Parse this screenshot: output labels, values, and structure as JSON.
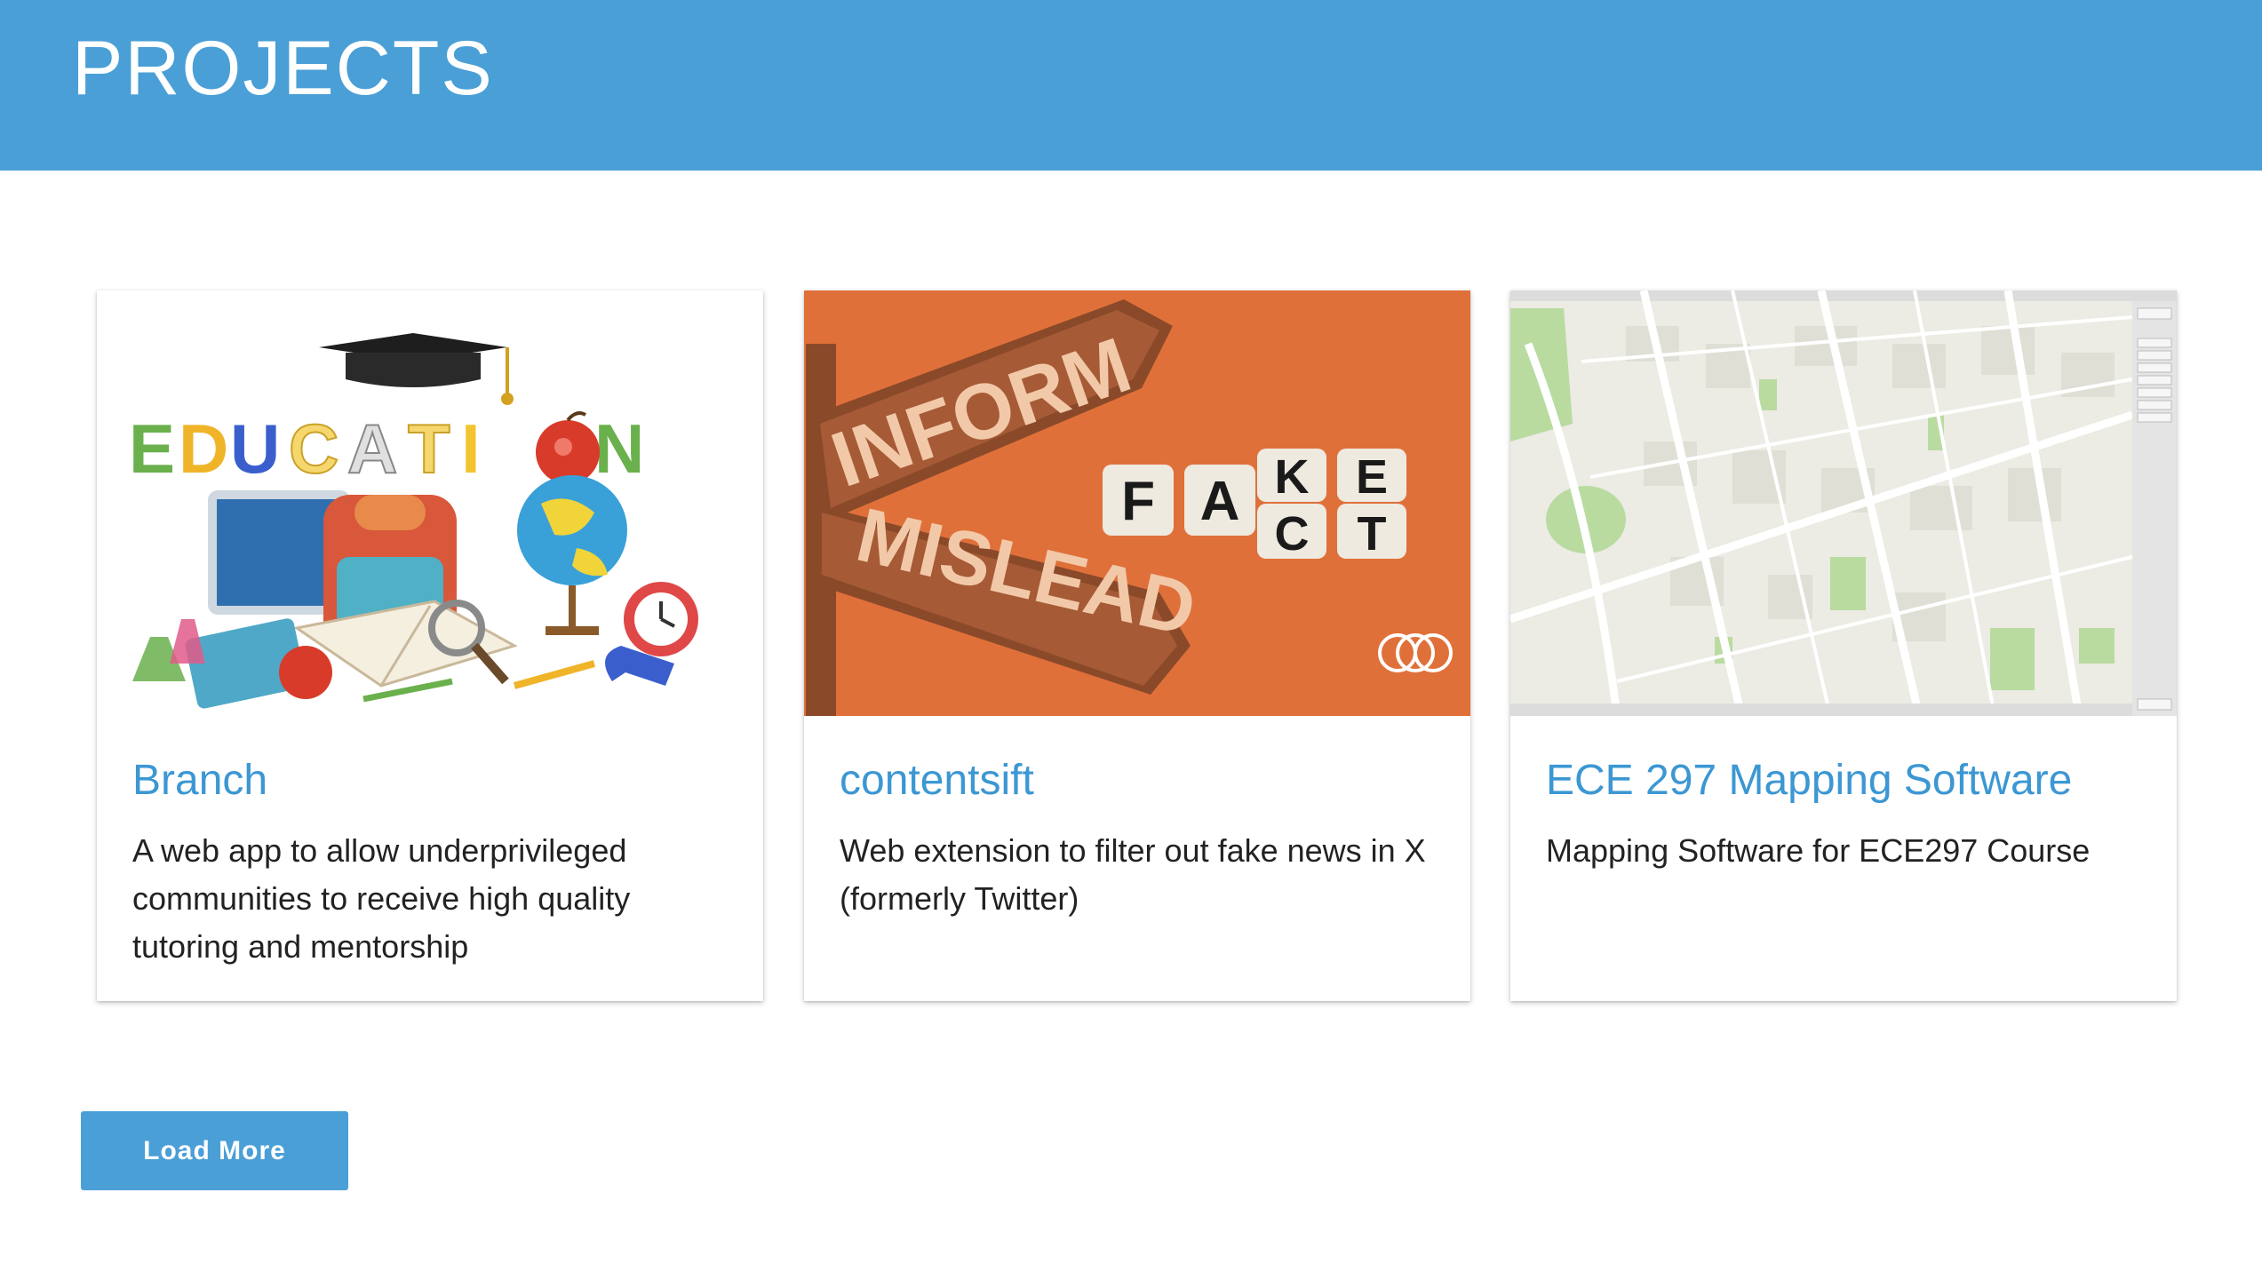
{
  "header": {
    "title": "PROJECTS"
  },
  "projects": [
    {
      "title": "Branch",
      "description": "A web app to allow underprivileged communities to receive high quality tutoring and mentorship",
      "image": {
        "icon": "education-illustration",
        "word": "EDUCATION"
      }
    },
    {
      "title": "contentsift",
      "description": "Web extension to filter out fake news in X (formerly Twitter)",
      "image": {
        "icon": "signpost-illustration",
        "sign_top": "INFORM",
        "sign_bottom": "MISLEAD",
        "dice_top": [
          "K",
          "E"
        ],
        "dice_bottom": [
          "F",
          "A",
          "C",
          "T"
        ],
        "background_color": "#e0703a"
      }
    },
    {
      "title": "ECE 297 Mapping Software",
      "description": "Mapping Software for ECE297 Course",
      "image": {
        "icon": "map-screenshot"
      }
    }
  ],
  "load_more": {
    "label": "Load More"
  },
  "colors": {
    "accent": "#4a9fd6",
    "title_blue": "#3c97d3"
  }
}
